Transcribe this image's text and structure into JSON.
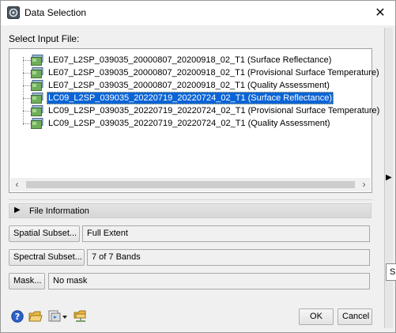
{
  "window": {
    "title": "Data Selection",
    "close_glyph": "✕"
  },
  "select_input_label": "Select Input File:",
  "files": [
    {
      "label": "LE07_L2SP_039035_20000807_20200918_02_T1 (Surface Reflectance)",
      "selected": false
    },
    {
      "label": "LE07_L2SP_039035_20000807_20200918_02_T1 (Provisional Surface Temperature)",
      "selected": false
    },
    {
      "label": "LE07_L2SP_039035_20000807_20200918_02_T1 (Quality Assessment)",
      "selected": false
    },
    {
      "label": "LC09_L2SP_039035_20220719_20220724_02_T1 (Surface Reflectance)",
      "selected": true
    },
    {
      "label": "LC09_L2SP_039035_20220719_20220724_02_T1 (Provisional Surface Temperature)",
      "selected": false
    },
    {
      "label": "LC09_L2SP_039035_20220719_20220724_02_T1 (Quality Assessment)",
      "selected": false
    }
  ],
  "file_information": {
    "label": "File Information"
  },
  "spatial_subset": {
    "button": "Spatial Subset...",
    "value": "Full Extent"
  },
  "spectral_subset": {
    "button": "Spectral Subset...",
    "value": "7 of 7 Bands"
  },
  "mask": {
    "button": "Mask...",
    "value": "No mask"
  },
  "buttons": {
    "ok": "OK",
    "cancel": "Cancel"
  },
  "tooltip_text": "S",
  "colors": {
    "selection": "#0a64d6",
    "help_icon": "#2a62c9",
    "folder_icon": "#e8b844"
  },
  "icons": [
    "help-icon",
    "open-folder-icon",
    "file-options-dropdown-icon",
    "network-folder-icon"
  ]
}
